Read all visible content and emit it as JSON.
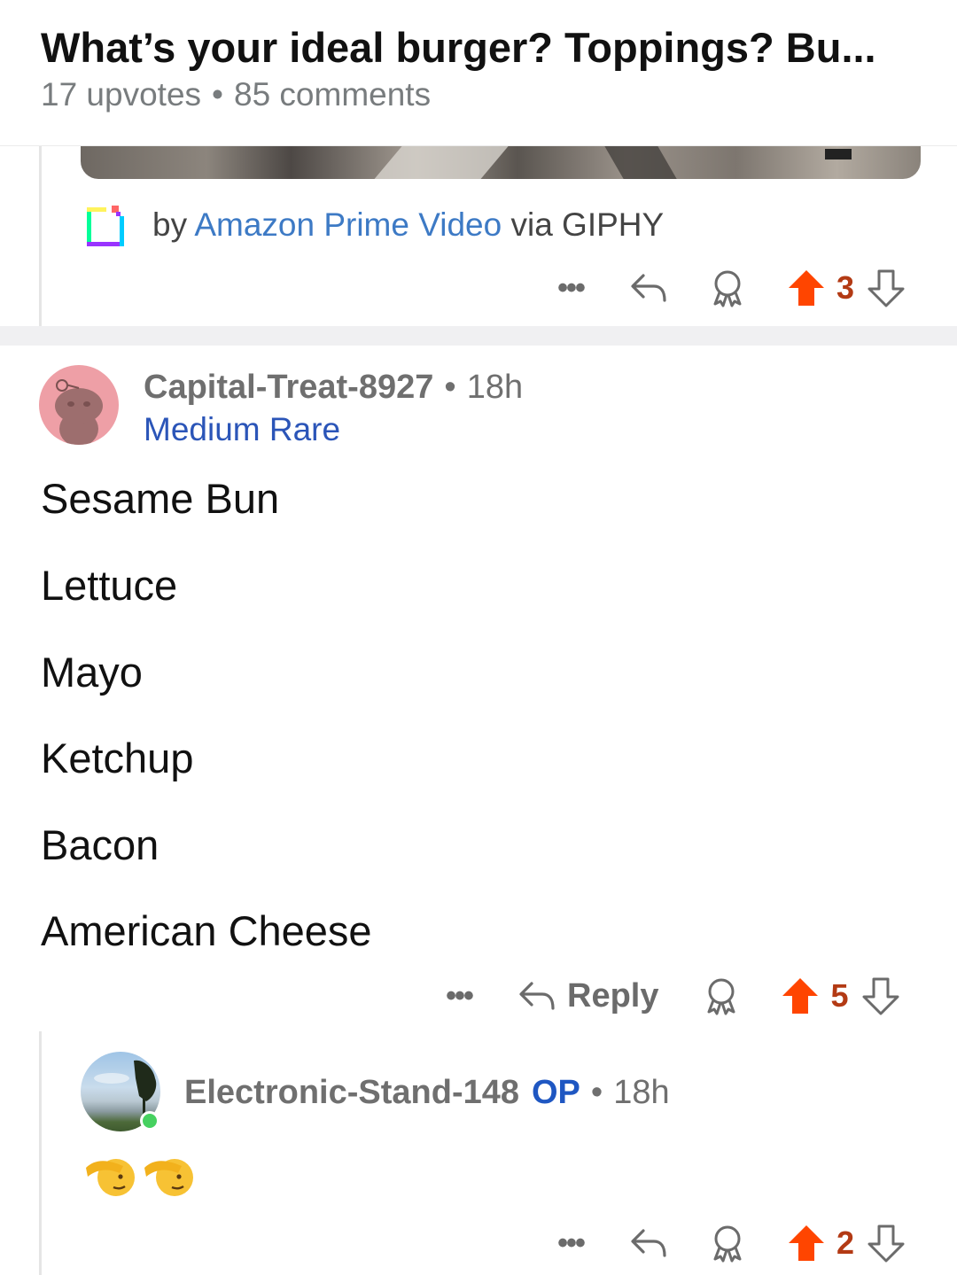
{
  "post": {
    "title": "What’s your ideal burger? Toppings? Bu...",
    "upvotes": "17 upvotes",
    "separator": "•",
    "comments": "85 comments"
  },
  "giphy": {
    "by": "by",
    "source": "Amazon Prime Video",
    "via": "via GIPHY"
  },
  "comment_prev": {
    "more": "•••",
    "score": "3"
  },
  "comment_main": {
    "username": "Capital-Treat-8927",
    "separator": "•",
    "time": "18h",
    "flair": "Medium Rare",
    "lines": [
      "Sesame Bun",
      "Lettuce",
      "Mayo",
      "Ketchup",
      "Bacon",
      "American Cheese"
    ],
    "more": "•••",
    "reply_label": "Reply",
    "score": "5"
  },
  "reply": {
    "username": "Electronic-Stand-148",
    "op_badge": "OP",
    "separator": "•",
    "time": "18h",
    "emoji": "🫡🫡",
    "more": "•••",
    "score": "2"
  },
  "colors": {
    "upvote": "#ff4500",
    "score": "#b33a14",
    "link": "#3d7ac5",
    "flair": "#2b55b8",
    "op": "#1f57c2",
    "online": "#46d160"
  },
  "icons": [
    "reply-arrow-icon",
    "award-icon",
    "upvote-arrow-icon",
    "downvote-arrow-icon",
    "giphy-logo-icon",
    "snoo-avatar-icon"
  ]
}
